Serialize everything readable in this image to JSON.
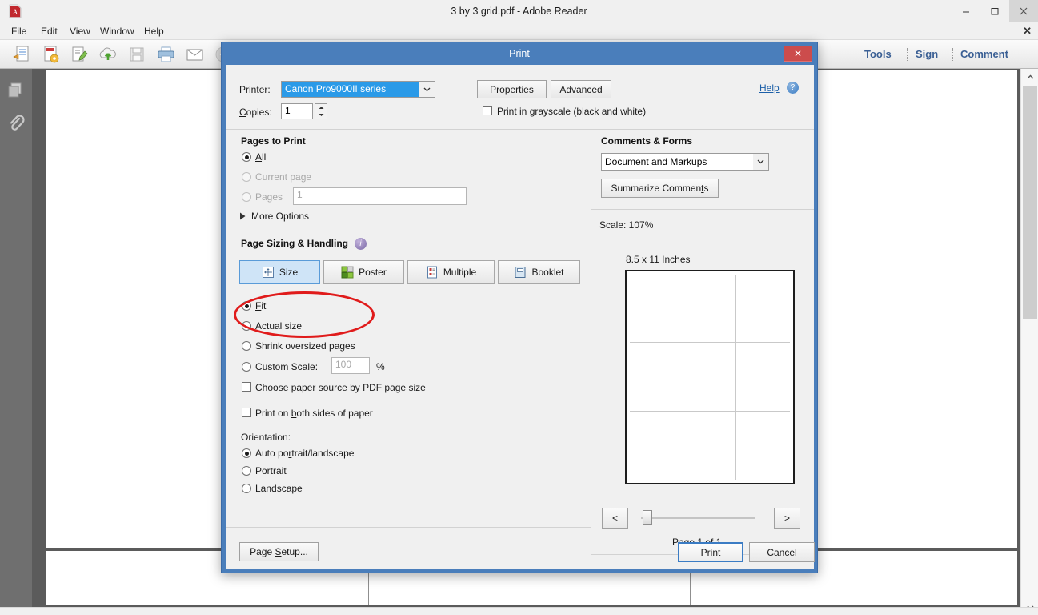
{
  "window": {
    "title": "3 by 3 grid.pdf - Adobe Reader",
    "app_icon": "pdf-icon",
    "minimize": "–",
    "maximize": "❑",
    "close": "✕"
  },
  "menubar": {
    "items": [
      "File",
      "Edit",
      "View",
      "Window",
      "Help"
    ],
    "close_tab": "✕"
  },
  "toolbar": {
    "icons": [
      "open-file-icon",
      "create-pdf-icon",
      "sign-edit-icon",
      "upload-cloud-icon",
      "save-icon",
      "print-icon",
      "email-icon"
    ],
    "right_buttons": [
      "Tools",
      "Sign",
      "Comment"
    ]
  },
  "navstrip": {
    "buttons": [
      "page-thumbnails-icon",
      "attachments-paperclip-icon"
    ]
  },
  "dialog": {
    "title": "Print",
    "close_label": "✕",
    "printer": {
      "label": "Printer:",
      "label_html": "Pri<u>n</u>ter:",
      "value": "Canon Pro9000II series",
      "properties_button": "Properties",
      "advanced_button": "Advanced"
    },
    "copies": {
      "label": "Copies:",
      "value": "1"
    },
    "grayscale": {
      "label": "Print in grayscale (black and white)",
      "checked": false
    },
    "help": {
      "label": "Help",
      "badge": "?"
    },
    "pages_to_print": {
      "title": "Pages to Print",
      "options": [
        {
          "label": "All",
          "selected": true,
          "disabled": false
        },
        {
          "label": "Current page",
          "selected": false,
          "disabled": true
        },
        {
          "label": "Pages",
          "selected": false,
          "disabled": true
        }
      ],
      "pages_value": "1",
      "more_options": "More Options",
      "more_options_arrow": "▶"
    },
    "page_sizing": {
      "title": "Page Sizing & Handling",
      "info_badge": "i",
      "mode_buttons": [
        {
          "label": "Size",
          "icon": "size-icon",
          "active": true
        },
        {
          "label": "Poster",
          "icon": "poster-icon",
          "active": false
        },
        {
          "label": "Multiple",
          "icon": "multiple-icon",
          "active": false
        },
        {
          "label": "Booklet",
          "icon": "booklet-icon",
          "active": false
        }
      ],
      "size_options": [
        {
          "label": "Fit",
          "selected": true
        },
        {
          "label": "Actual size",
          "selected": false
        },
        {
          "label": "Shrink oversized pages",
          "selected": false
        },
        {
          "label": "Custom Scale:",
          "selected": false
        }
      ],
      "custom_scale_value": "100",
      "percent_symbol": "%",
      "paper_source": {
        "label": "Choose paper source by PDF page size",
        "checked": false
      }
    },
    "duplex": {
      "label": "Print on both sides of paper",
      "checked": false
    },
    "orientation": {
      "title": "Orientation:",
      "options": [
        {
          "label": "Auto portrait/landscape",
          "selected": true
        },
        {
          "label": "Portrait",
          "selected": false
        },
        {
          "label": "Landscape",
          "selected": false
        }
      ]
    },
    "comments_forms": {
      "title": "Comments & Forms",
      "value": "Document and Markups",
      "summarize_button": "Summarize Comments"
    },
    "preview": {
      "scale_text": "Scale: 107%",
      "paper_size": "8.5 x 11 Inches",
      "grid_rows": 3,
      "grid_cols": 3,
      "prev_page": "<",
      "next_page": ">",
      "page_indicator": "Page 1 of 1"
    },
    "footer": {
      "page_setup": "Page Setup...",
      "print": "Print",
      "cancel": "Cancel"
    },
    "annotation": {
      "type": "red-ellipse-highlight",
      "color": "#e01b1b",
      "targets": [
        "Fit",
        "Actual size"
      ]
    }
  },
  "colors": {
    "dialog_accent": "#4a7ebb",
    "dialog_body": "#f0f0f0",
    "combo_selected": "#2a9ae8",
    "link": "#1c5fa8",
    "annotation_red": "#e01b1b",
    "doc_background": "#5b5b5b",
    "nav_strip": "#6f6f6f"
  }
}
